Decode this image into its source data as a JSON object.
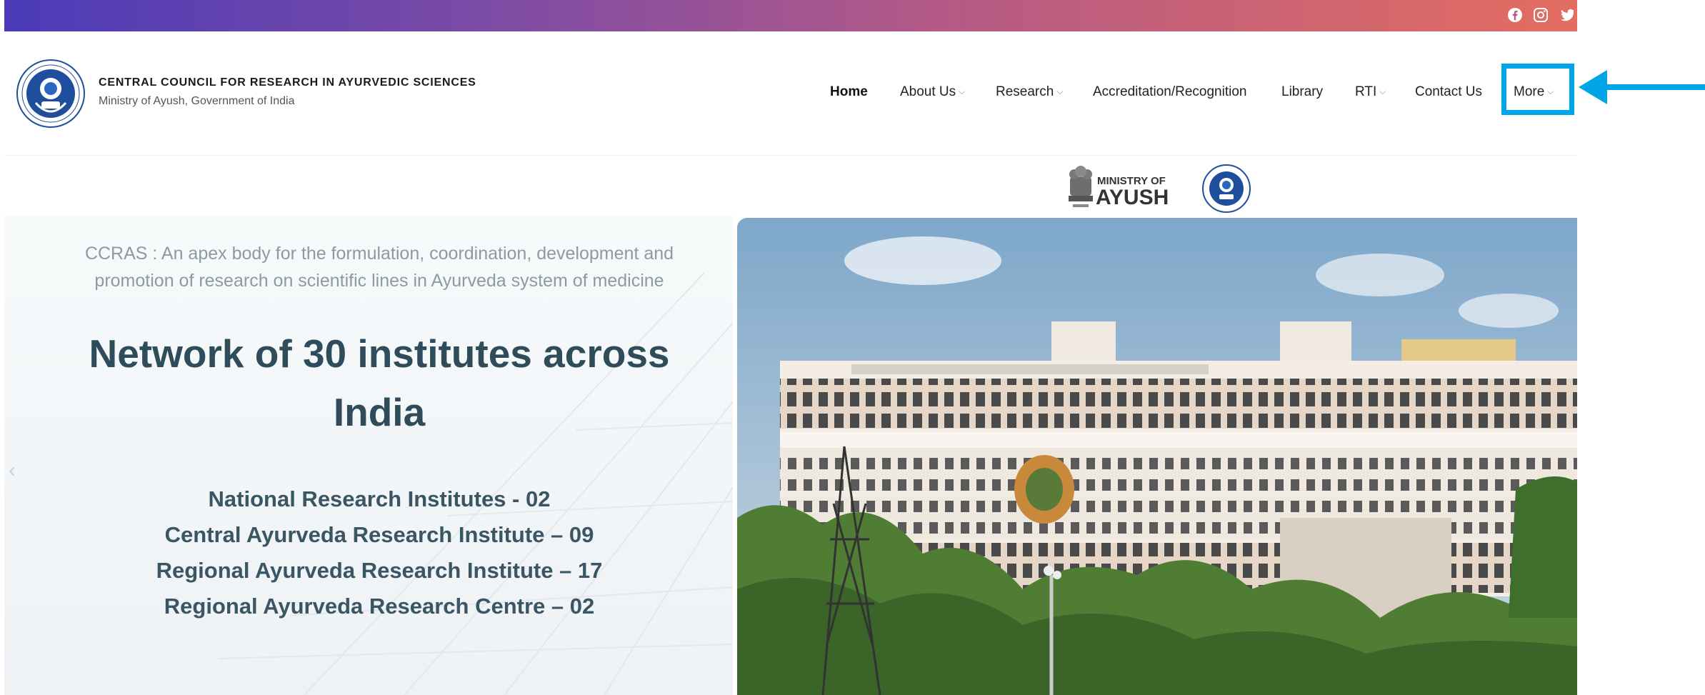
{
  "topbar": {
    "social": [
      "facebook-icon",
      "instagram-icon",
      "twitter-icon"
    ]
  },
  "header": {
    "org_name": "CENTRAL COUNCIL FOR RESEARCH IN AYURVEDIC SCIENCES",
    "org_sub": "Ministry of Ayush, Government of India"
  },
  "nav": {
    "items": [
      {
        "label": "Home",
        "dropdown": false
      },
      {
        "label": "About Us",
        "dropdown": true
      },
      {
        "label": "Research",
        "dropdown": true
      },
      {
        "label": "Accreditation/Recognition",
        "dropdown": false
      },
      {
        "label": "Library",
        "dropdown": false
      },
      {
        "label": "RTI",
        "dropdown": true
      },
      {
        "label": "Contact Us",
        "dropdown": false
      },
      {
        "label": "More",
        "dropdown": true
      }
    ],
    "chevron": "⌵"
  },
  "ministry": {
    "line1": "MINISTRY OF",
    "line2": "AYUSH"
  },
  "hero": {
    "intro_line1": "CCRAS : An apex body for the formulation, coordination, development and",
    "intro_line2": "promotion of research on scientific lines in Ayurveda system of medicine",
    "heading_line1": "Network of 30 institutes across",
    "heading_line2": "India",
    "list": [
      "National Research Institutes - 02",
      "Central Ayurveda Research Institute – 09",
      "Regional Ayurveda Research Institute – 17",
      "Regional Ayurveda Research Centre – 02"
    ],
    "prev_glyph": "‹"
  },
  "colors": {
    "accent_highlight": "#00a5e8",
    "heading": "#2f4c5b"
  }
}
